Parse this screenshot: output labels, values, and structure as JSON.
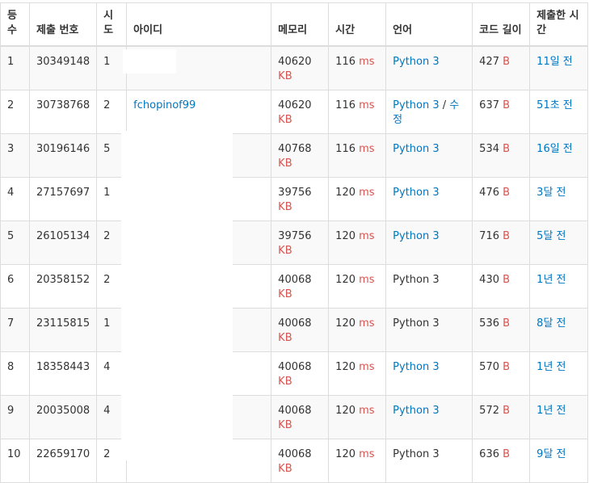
{
  "headers": [
    "등수",
    "제출 번호",
    "시도",
    "아이디",
    "메모리",
    "시간",
    "언어",
    "코드 길이",
    "제출한 시간"
  ],
  "units": {
    "memory": "KB",
    "time": "ms",
    "code": "B"
  },
  "edit_label": "수정",
  "edit_separator": " / ",
  "rows": [
    {
      "rank": "1",
      "submission": "30349148",
      "tries": "1",
      "user": "",
      "memory": "40620",
      "time": "116",
      "lang": "Python 3",
      "lang_link": true,
      "code": "427",
      "submitted": "11일 전"
    },
    {
      "rank": "2",
      "submission": "30738768",
      "tries": "2",
      "user": "fchopinof99",
      "memory": "40620",
      "time": "116",
      "lang": "Python 3",
      "lang_link": true,
      "editable": true,
      "code": "637",
      "submitted": "51초 전"
    },
    {
      "rank": "3",
      "submission": "30196146",
      "tries": "5",
      "user": "",
      "memory": "40768",
      "time": "116",
      "lang": "Python 3",
      "lang_link": true,
      "code": "534",
      "submitted": "16일 전"
    },
    {
      "rank": "4",
      "submission": "27157697",
      "tries": "1",
      "user": "",
      "memory": "39756",
      "time": "120",
      "lang": "Python 3",
      "lang_link": true,
      "code": "476",
      "submitted": "3달 전"
    },
    {
      "rank": "5",
      "submission": "26105134",
      "tries": "2",
      "user": "",
      "memory": "39756",
      "time": "120",
      "lang": "Python 3",
      "lang_link": true,
      "code": "716",
      "submitted": "5달 전"
    },
    {
      "rank": "6",
      "submission": "20358152",
      "tries": "2",
      "user": "",
      "memory": "40068",
      "time": "120",
      "lang": "Python 3",
      "lang_link": false,
      "code": "430",
      "submitted": "1년 전"
    },
    {
      "rank": "7",
      "submission": "23115815",
      "tries": "1",
      "user": "",
      "memory": "40068",
      "time": "120",
      "lang": "Python 3",
      "lang_link": false,
      "code": "536",
      "submitted": "8달 전"
    },
    {
      "rank": "8",
      "submission": "18358443",
      "tries": "4",
      "user": "",
      "memory": "40068",
      "time": "120",
      "lang": "Python 3",
      "lang_link": true,
      "code": "570",
      "submitted": "1년 전"
    },
    {
      "rank": "9",
      "submission": "20035008",
      "tries": "4",
      "user": "",
      "memory": "40068",
      "time": "120",
      "lang": "Python 3",
      "lang_link": true,
      "code": "572",
      "submitted": "1년 전"
    },
    {
      "rank": "10",
      "submission": "22659170",
      "tries": "2",
      "user": "",
      "memory": "40068",
      "time": "120",
      "lang": "Python 3",
      "lang_link": false,
      "code": "636",
      "submitted": "9달 전"
    }
  ]
}
